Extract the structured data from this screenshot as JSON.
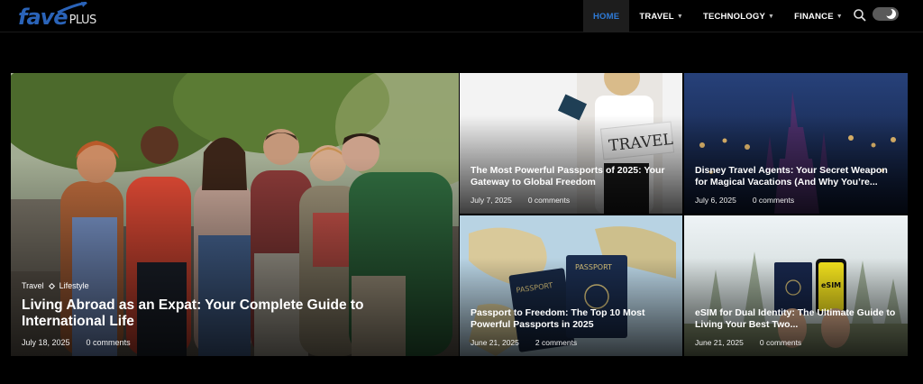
{
  "header": {
    "logo_main": "fave",
    "logo_plus": "PLUS",
    "nav": [
      {
        "label": "HOME",
        "active": true
      },
      {
        "label": "TRAVEL",
        "has_caret": true
      },
      {
        "label": "TECHNOLOGY",
        "has_caret": true
      },
      {
        "label": "FINANCE",
        "has_caret": true
      }
    ],
    "search_icon": "search-icon",
    "theme_toggle_icon": "moon-icon"
  },
  "featured": {
    "categories": [
      "Travel",
      "Lifestyle"
    ],
    "title": "Living Abroad as an Expat: Your Complete Guide to International Life",
    "date": "July 18, 2025",
    "comments": "0 comments"
  },
  "posts": [
    {
      "title": "The Most Powerful Passports of 2025: Your Gateway to Global Freedom",
      "date": "July 7, 2025",
      "comments": "0 comments"
    },
    {
      "title": "Disney Travel Agents: Your Secret Weapon for Magical Vacations (And Why You’re...",
      "date": "July 6, 2025",
      "comments": "0 comments"
    },
    {
      "title": "Passport to Freedom: The Top 10 Most Powerful Passports in 2025",
      "date": "June 21, 2025",
      "comments": "2 comments"
    },
    {
      "title": "eSIM for Dual Identity: The Ultimate Guide to Living Your Best Two...",
      "date": "June 21, 2025",
      "comments": "0 comments"
    }
  ],
  "colors": {
    "accent": "#2e7ad6",
    "background": "#000000",
    "logo": "#2a63b8"
  }
}
